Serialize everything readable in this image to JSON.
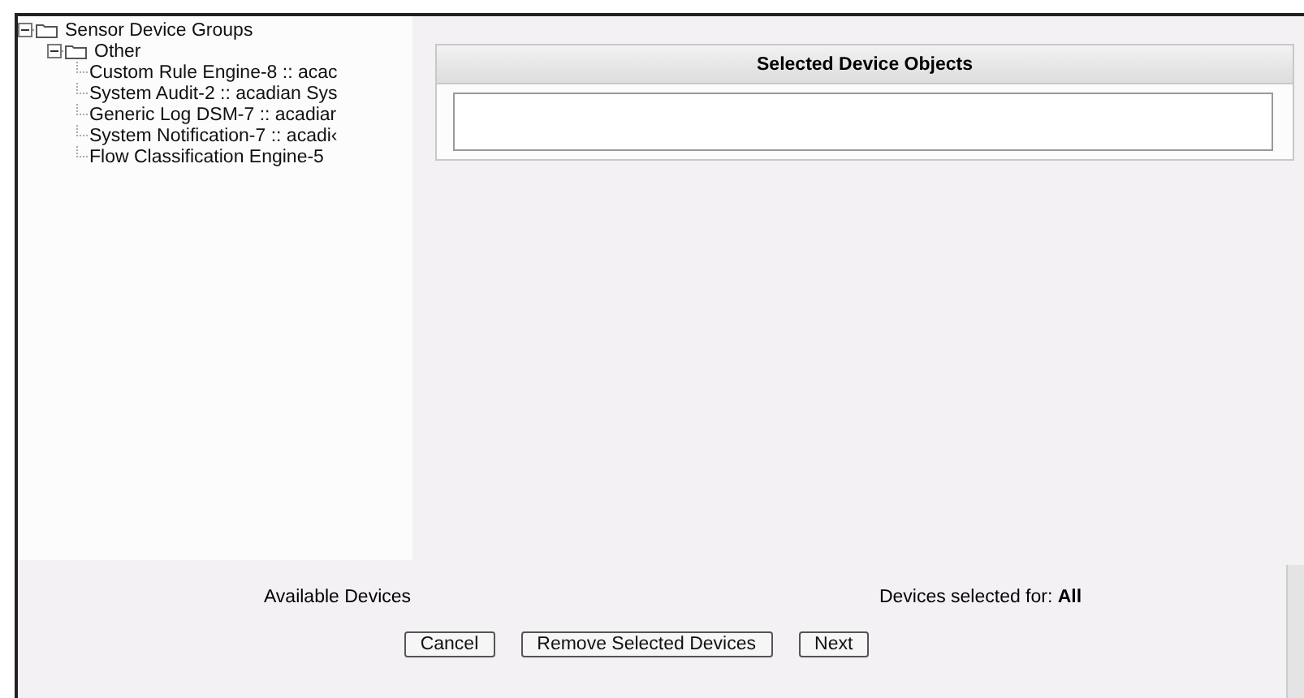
{
  "tree": {
    "label": "Sensor Device Groups",
    "expanded": true,
    "children": [
      {
        "label": "Other",
        "expanded": true,
        "children": [
          {
            "label": "Custom Rule Engine-8 :: acac"
          },
          {
            "label": "System Audit-2 :: acadian  Sys"
          },
          {
            "label": "Generic Log DSM-7 :: acadiar"
          },
          {
            "label": "System Notification-7 :: acadi‹"
          },
          {
            "label": "Flow Classification Engine-5"
          }
        ]
      }
    ]
  },
  "selected_panel": {
    "title": "Selected Device Objects"
  },
  "available_label": "Available Devices",
  "selected_for": {
    "label": "Devices selected for: ",
    "value": "All"
  },
  "buttons": [
    {
      "label": "Cancel"
    },
    {
      "label": "Remove Selected Devices"
    },
    {
      "label": "Next"
    }
  ]
}
